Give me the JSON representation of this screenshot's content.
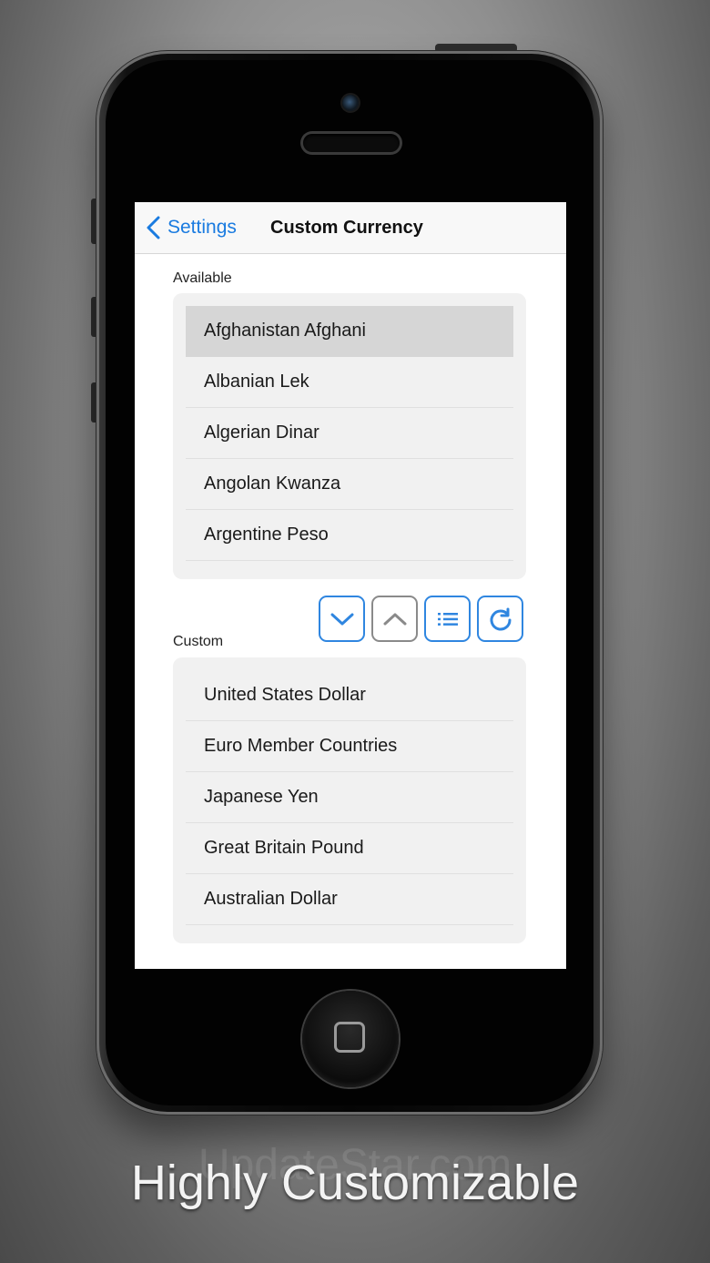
{
  "navbar": {
    "back_label": "Settings",
    "title": "Custom Currency"
  },
  "available": {
    "label": "Available",
    "items": [
      {
        "label": "Afghanistan Afghani",
        "selected": true
      },
      {
        "label": "Albanian Lek",
        "selected": false
      },
      {
        "label": "Algerian Dinar",
        "selected": false
      },
      {
        "label": "Angolan Kwanza",
        "selected": false
      },
      {
        "label": "Argentine Peso",
        "selected": false
      }
    ]
  },
  "toolbar": {
    "buttons": [
      {
        "icon": "chevron-down-icon",
        "enabled": true
      },
      {
        "icon": "chevron-up-icon",
        "enabled": false
      },
      {
        "icon": "list-icon",
        "enabled": true
      },
      {
        "icon": "refresh-icon",
        "enabled": true
      }
    ]
  },
  "custom": {
    "label": "Custom",
    "items": [
      {
        "label": "United States Dollar"
      },
      {
        "label": "Euro Member Countries"
      },
      {
        "label": "Japanese Yen"
      },
      {
        "label": "Great Britain Pound"
      },
      {
        "label": "Australian Dollar"
      }
    ]
  },
  "tagline": "Highly Customizable",
  "watermark": "UpdateStar.com",
  "colors": {
    "accent": "#2f86e0",
    "disabled": "#8a8a8a",
    "selected_row": "#d6d6d6",
    "list_bg": "#f1f1f1"
  }
}
